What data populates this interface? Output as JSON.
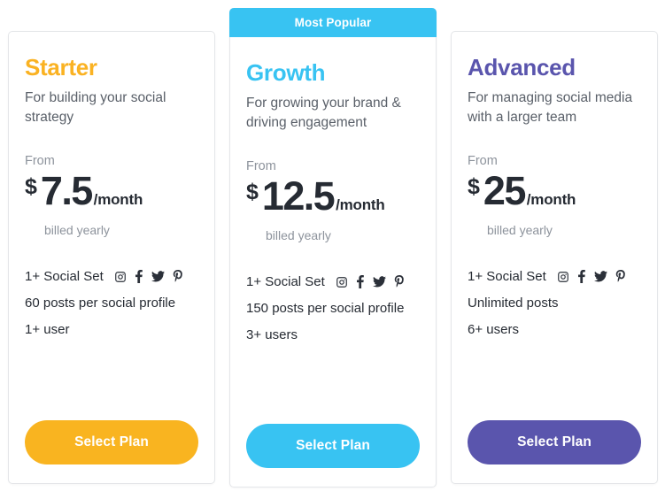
{
  "badge": {
    "label": "Most Popular"
  },
  "currency_symbol": "$",
  "per_month_label": "/month",
  "from_label": "From",
  "billed_note": "billed yearly",
  "social_icons": [
    "instagram-icon",
    "facebook-icon",
    "twitter-icon",
    "pinterest-icon"
  ],
  "colors": {
    "starter": "#fab222",
    "growth": "#38c3f2",
    "advanced": "#5a55ad",
    "text": "#262b33",
    "muted": "#8d939c",
    "tagline": "#5a6069",
    "card_border": "#e4e6e9"
  },
  "plans": [
    {
      "name": "Starter",
      "tagline": "For building your social strategy",
      "from_label": "From",
      "currency": "$",
      "price": "7.5",
      "per_month": "/month",
      "billed_note": "billed yearly",
      "features": [
        "1+ Social Set",
        "60 posts per social profile",
        "1+ user"
      ],
      "cta_label": "Select Plan",
      "accent": "#fab222",
      "popular": false
    },
    {
      "name": "Growth",
      "tagline": "For growing your brand & driving engagement",
      "from_label": "From",
      "currency": "$",
      "price": "12.5",
      "per_month": "/month",
      "billed_note": "billed yearly",
      "features": [
        "1+ Social Set",
        "150 posts per social profile",
        "3+ users"
      ],
      "cta_label": "Select Plan",
      "accent": "#38c3f2",
      "popular": true,
      "badge_label": "Most Popular"
    },
    {
      "name": "Advanced",
      "tagline": "For managing social media with a larger team",
      "from_label": "From",
      "currency": "$",
      "price": "25",
      "per_month": "/month",
      "billed_note": "billed yearly",
      "features": [
        "1+ Social Set",
        "Unlimited posts",
        "6+ users"
      ],
      "cta_label": "Select Plan",
      "accent": "#5a55ad",
      "popular": false
    }
  ]
}
